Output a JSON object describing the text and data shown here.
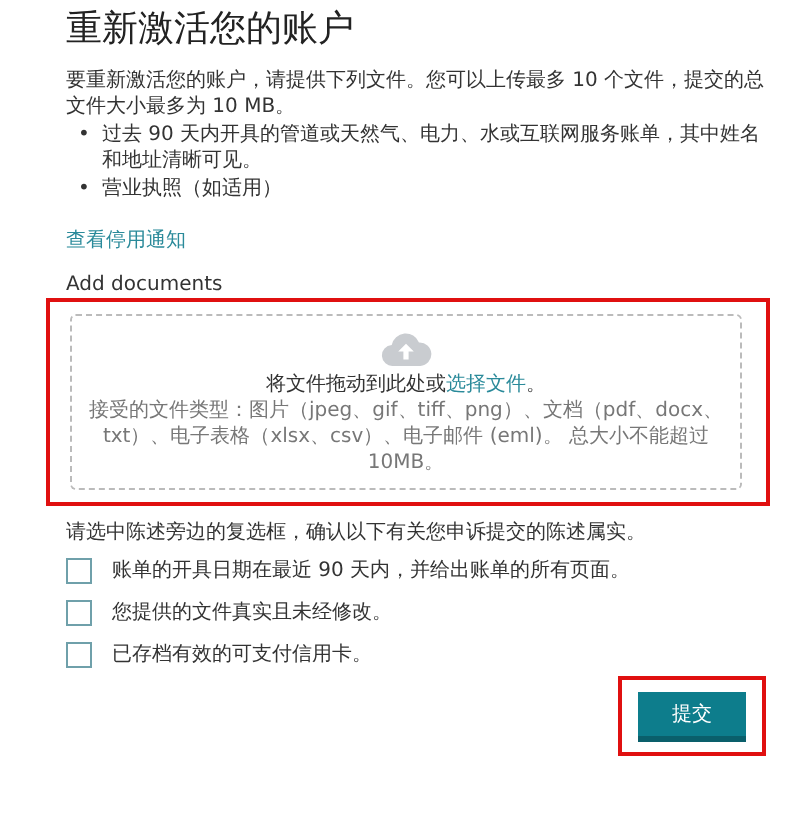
{
  "title": "重新激活您的账户",
  "intro": "要重新激活您的账户，请提供下列文件。您可以上传最多 10 个文件，提交的总文件大小最多为 10 MB。",
  "bullets": [
    {
      "marker": "•",
      "text": "过去 90 天内开具的管道或天然气、电力、水或互联网服务账单，其中姓名和地址清晰可见。"
    },
    {
      "marker": "•",
      "text": "营业执照（如适用）"
    }
  ],
  "notice_link": "查看停用通知",
  "upload": {
    "label": "Add documents",
    "highlighted": true,
    "prompt": "将文件拖动到此处或",
    "prompt_link": "选择文件",
    "prompt_end": "。",
    "accepted": "接受的文件类型：图片（jpeg、gif、tiff、png）、文档（pdf、docx、txt）、电子表格（xlsx、csv）、电子邮件 (eml)。 总大小不能超过 10MB。"
  },
  "confirm_text": "请选中陈述旁边的复选框，确认以下有关您申诉提交的陈述属实。",
  "checkboxes": [
    {
      "label": "账单的开具日期在最近 90 天内，并给出账单的所有页面。",
      "checked": false
    },
    {
      "label": "您提供的文件真实且未经修改。",
      "checked": false
    },
    {
      "label": "已存档有效的可支付信用卡。",
      "checked": false
    }
  ],
  "submit": {
    "label": "提交",
    "highlighted": true
  }
}
